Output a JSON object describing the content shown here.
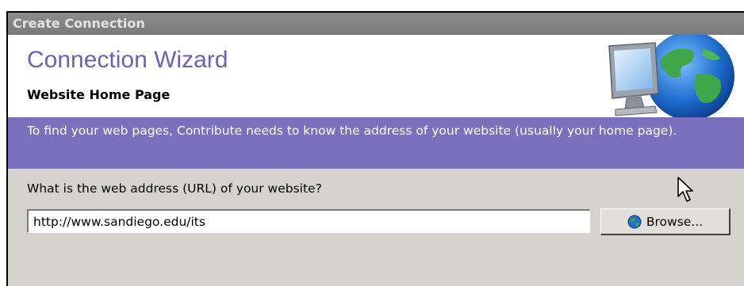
{
  "window": {
    "title": "Create Connection"
  },
  "header": {
    "title": "Connection Wizard",
    "subtitle": "Website Home Page",
    "graphic_icon": "monitor-globe-icon"
  },
  "banner": {
    "text": "To find your web pages, Contribute needs to know the address of your website (usually your home page)."
  },
  "form": {
    "question": "What is the web address (URL) of your website?",
    "url_value": "http://www.sandiego.edu/its",
    "browse_label": "Browse...",
    "browse_icon": "globe-icon"
  },
  "colors": {
    "title_purple": "#6f5fb8",
    "banner_purple": "#7b70bd",
    "titlebar_gray": "#808080",
    "panel_gray": "#d6d3ce"
  }
}
